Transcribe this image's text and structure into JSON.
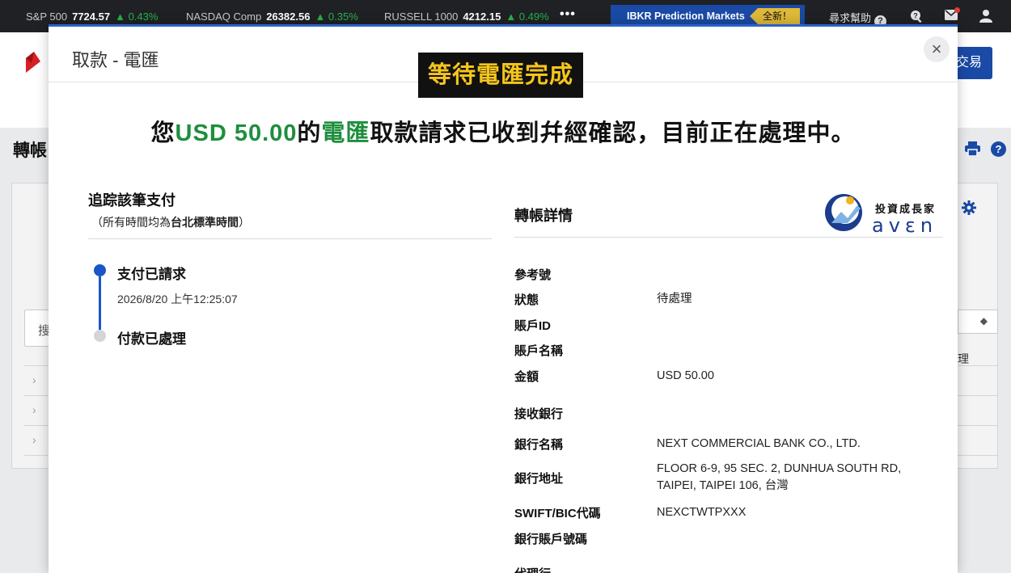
{
  "ticker": [
    {
      "name": "S&P 500",
      "value": "7724.57",
      "change": "▲ 0.43%"
    },
    {
      "name": "NASDAQ Comp",
      "value": "26382.56",
      "change": "▲ 0.35%"
    },
    {
      "name": "RUSSELL 1000",
      "value": "4212.15",
      "change": "▲ 0.49%"
    }
  ],
  "topbar": {
    "more_icon": "•••",
    "prediction_label": "IBKR Prediction Markets",
    "prediction_badge": "全新！",
    "help_label": "尋求幫助",
    "help_icon": "?",
    "icons": [
      "question-search-icon",
      "mail-icon",
      "user-icon"
    ]
  },
  "background": {
    "trade_button": "交易",
    "page_title": "轉帳",
    "search_placeholder": "搜",
    "list_item": "理",
    "help_icon": "?"
  },
  "modal": {
    "title": "取款 - 電匯",
    "close": "×",
    "overlay_label": "等待電匯完成",
    "headline": {
      "prefix": "您",
      "amount": "USD 50.00",
      "mid": "的",
      "method": "電匯",
      "suffix": "取款請求已收到幷經確認，目前正在處理中。"
    },
    "tracking": {
      "title": "追踪該筆支付",
      "subtitle_prefix": "（所有時間均為",
      "subtitle_bold": "台北標準時間",
      "subtitle_suffix": "）",
      "steps": [
        {
          "label": "支付已請求",
          "date": "2026/8/20 上午12:25:07"
        },
        {
          "label": "付款已處理"
        }
      ]
    },
    "brand": {
      "cn": "投資成長家",
      "en": "avεn"
    },
    "details": {
      "title": "轉帳詳情",
      "rows": [
        {
          "label": "參考號",
          "value": ""
        },
        {
          "label": "狀態",
          "value": "待處理"
        },
        {
          "label": "賬戶ID",
          "value": ""
        },
        {
          "label": "賬戶名稱",
          "value": ""
        },
        {
          "label": "金額",
          "value": "USD 50.00"
        },
        {
          "label": "接收銀行",
          "value": ""
        },
        {
          "label": "銀行名稱",
          "value": "NEXT COMMERCIAL BANK CO., LTD."
        },
        {
          "label": "銀行地址",
          "value": "FLOOR 6-9, 95 SEC. 2, DUNHUA SOUTH RD,",
          "value2": "TAIPEI, TAIPEI 106, 台灣"
        },
        {
          "label": "SWIFT/BIC代碼",
          "value": "NEXCTWTPXXX"
        },
        {
          "label": "銀行賬戶號碼",
          "value": ""
        },
        {
          "label": "代理行",
          "value": ""
        }
      ]
    }
  }
}
